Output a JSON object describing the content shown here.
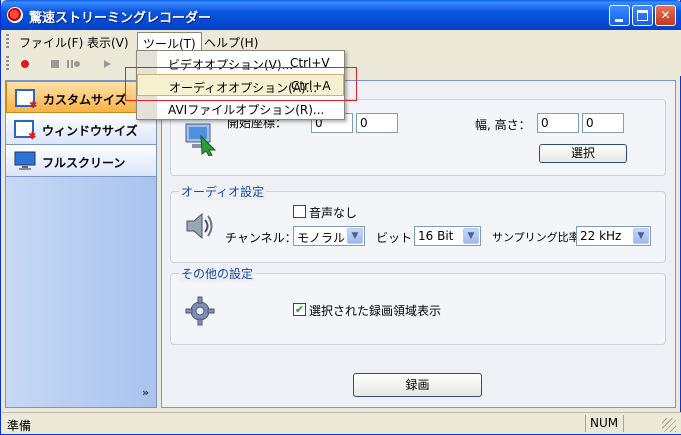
{
  "window": {
    "title": "驚速ストリーミングレコーダー"
  },
  "menubar": {
    "items": [
      {
        "label": "ファイル(F)"
      },
      {
        "label": "表示(V)"
      },
      {
        "label": "ツール(T)"
      },
      {
        "label": "ヘルプ(H)"
      }
    ]
  },
  "tools_menu": {
    "items": [
      {
        "label": "ビデオオプション(V)...",
        "shortcut": "Ctrl+V"
      },
      {
        "label": "オーディオオプション(A)...",
        "shortcut": "Ctrl+A"
      },
      {
        "label": "AVIファイルオプション(R)...",
        "shortcut": ""
      }
    ]
  },
  "sidebar": {
    "items": [
      {
        "label": "カスタムサイズ"
      },
      {
        "label": "ウィンドウサイズ"
      },
      {
        "label": "フルスクリーン"
      }
    ],
    "more_glyph": "»"
  },
  "region": {
    "coord_label": "開始座標：",
    "x_value": "0",
    "y_value": "0",
    "size_label": "幅, 高さ：",
    "width_value": "0",
    "height_value": "0",
    "select_button": "選択"
  },
  "audio": {
    "group_title": "オーディオ設定",
    "mute_label": "音声なし",
    "mute_checked": false,
    "channel_label": "チャンネル：",
    "channel_value": "モノラル",
    "bit_label": "ビット：",
    "bit_value": "16 Bit",
    "rate_label": "サンプリング比率：",
    "rate_value": "22 kHz"
  },
  "other": {
    "group_title": "その他の設定",
    "show_region_label": "選択された録画領域表示",
    "show_region_checked": true
  },
  "record_button": "録画",
  "statusbar": {
    "text": "準備",
    "num": "NUM"
  },
  "colors": {
    "titlebar": "#0346d0",
    "highlight_frame": "#e0202a",
    "group_title": "#1747a6"
  }
}
